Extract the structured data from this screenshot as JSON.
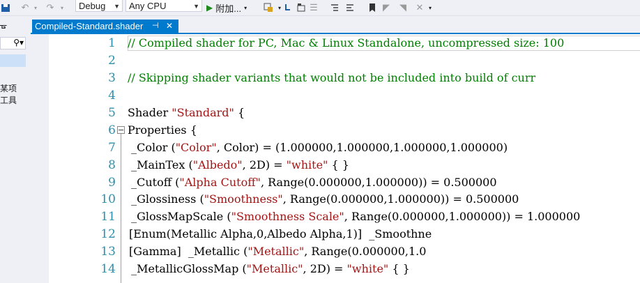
{
  "toolbar": {
    "config_value": "Debug",
    "platform_value": "Any CPU",
    "attach_label": "附加..."
  },
  "left_panel": {
    "pin_glyph": "ᚗ",
    "text_line1": "某项",
    "text_line2": "工具"
  },
  "tab": {
    "title": "Compiled-Standard.shader",
    "pin_glyph": "⊣",
    "close_glyph": "✕"
  },
  "editor": {
    "line_numbers": [
      "1",
      "2",
      "3",
      "4",
      "5",
      "6",
      "7",
      "8",
      "9",
      "10",
      "11",
      "12",
      "13",
      "14"
    ],
    "lines": {
      "l1": "// Compiled shader for PC, Mac & Linux Standalone, uncompressed size: 100",
      "l3": "// Skipping shader variants that would not be included into build of curr",
      "l5a": "Shader ",
      "l5b": "\"Standard\"",
      "l5c": " {",
      "l6": "Properties {",
      "l7a": " _Color (",
      "l7b": "\"Color\"",
      "l7c": ", Color) = (1.000000,1.000000,1.000000,1.000000)",
      "l8a": " _MainTex (",
      "l8b": "\"Albedo\"",
      "l8c": ", 2D) = ",
      "l8d": "\"white\"",
      "l8e": " { }",
      "l9a": " _Cutoff (",
      "l9b": "\"Alpha Cutoff\"",
      "l9c": ", Range(0.000000,1.000000)) = 0.500000",
      "l10a": " _Glossiness (",
      "l10b": "\"Smoothness\"",
      "l10c": ", Range(0.000000,1.000000)) = 0.500000",
      "l11a": " _GlossMapScale (",
      "l11b": "\"Smoothness Scale\"",
      "l11c": ", Range(0.000000,1.000000)) = 1.000000",
      "l12": "[Enum(Metallic Alpha,0,Albedo Alpha,1)]  _Smoothne",
      "l13a": "[Gamma]  _Metallic (",
      "l13b": "\"Metallic\"",
      "l13c": ", Range(0.000000,1.0",
      "l14a": " _MetallicGlossMap (",
      "l14b": "\"Metallic\"",
      "l14c": ", 2D) = ",
      "l14d": "\"white\"",
      "l14e": " { }"
    }
  },
  "colors": {
    "accent": "#007acc",
    "comment": "#008000",
    "string": "#a31515",
    "line_number": "#2b91af"
  }
}
